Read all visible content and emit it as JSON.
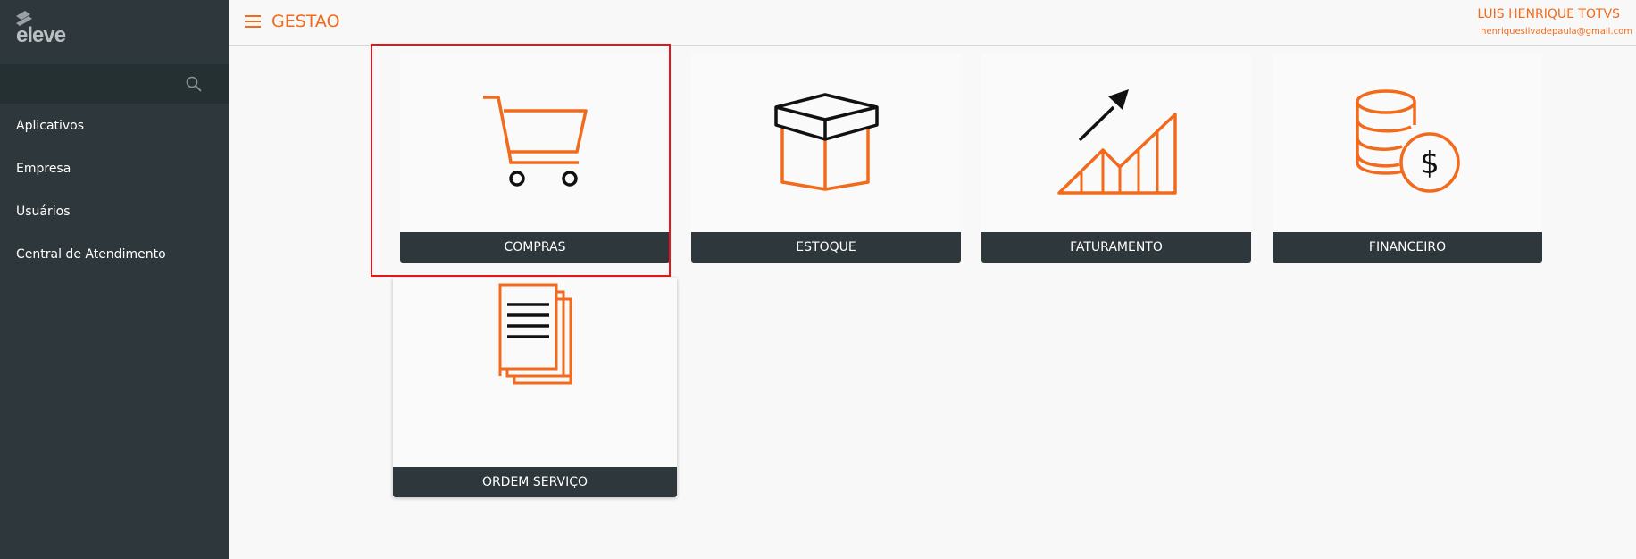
{
  "brand": {
    "logo_text": "eleve"
  },
  "sidebar": {
    "search": {
      "placeholder": ""
    },
    "items": [
      {
        "label": "Aplicativos"
      },
      {
        "label": "Empresa"
      },
      {
        "label": "Usuários"
      },
      {
        "label": "Central de Atendimento"
      }
    ]
  },
  "header": {
    "title": "GESTAO",
    "user_name": "LUIS HENRIQUE TOTVS",
    "user_email": "henriquesilvadepaula@gmail.com"
  },
  "cards": [
    {
      "label": "COMPRAS",
      "icon": "shopping-cart-icon"
    },
    {
      "label": "ESTOQUE",
      "icon": "box-icon"
    },
    {
      "label": "FATURAMENTO",
      "icon": "growth-chart-icon"
    },
    {
      "label": "FINANCEIRO",
      "icon": "coins-dollar-icon"
    },
    {
      "label": "ORDEM SERVIÇO",
      "icon": "documents-icon"
    }
  ],
  "colors": {
    "accent": "#f26a1b",
    "sidebar_bg": "#2e373b",
    "card_label_bg": "#2e373b",
    "highlight": "#e8141c"
  }
}
